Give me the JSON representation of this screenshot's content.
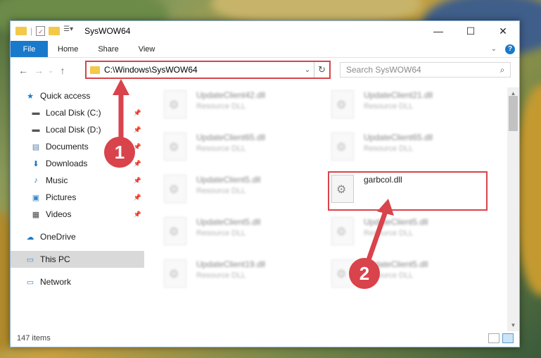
{
  "window": {
    "title": "SysWOW64",
    "controls": {
      "minimize": "—",
      "maximize": "☐",
      "close": "✕"
    }
  },
  "ribbon": {
    "tabs": [
      "File",
      "Home",
      "Share",
      "View"
    ],
    "help": "?"
  },
  "address": {
    "path": "C:\\Windows\\SysWOW64"
  },
  "search": {
    "placeholder": "Search SysWOW64"
  },
  "sidebar": {
    "quick_access": "Quick access",
    "items": [
      {
        "label": "Local Disk (C:)",
        "icon": "disk-icon",
        "pinned": true
      },
      {
        "label": "Local Disk (D:)",
        "icon": "disk-icon",
        "pinned": true
      },
      {
        "label": "Documents",
        "icon": "documents-icon",
        "pinned": true
      },
      {
        "label": "Downloads",
        "icon": "downloads-icon",
        "pinned": true
      },
      {
        "label": "Music",
        "icon": "music-icon",
        "pinned": true
      },
      {
        "label": "Pictures",
        "icon": "pictures-icon",
        "pinned": true
      },
      {
        "label": "Videos",
        "icon": "videos-icon",
        "pinned": true
      }
    ],
    "onedrive": "OneDrive",
    "this_pc": "This PC",
    "network": "Network"
  },
  "files": [
    {
      "name": "UpdateClient42.dll",
      "type": "Resource DLL"
    },
    {
      "name": "UpdateClient21.dll",
      "type": "Resource DLL"
    },
    {
      "name": "UpdateClient65.dll",
      "type": "Resource DLL"
    },
    {
      "name": "UpdateClient65.dll",
      "type": "Resource DLL"
    },
    {
      "name": "UpdateClient5.dll",
      "type": "Resource DLL"
    },
    {
      "name": "garbcol.dll",
      "type": ""
    },
    {
      "name": "UpdateClient5.dll",
      "type": "Resource DLL"
    },
    {
      "name": "UpdateClient5.dll",
      "type": "Resource DLL"
    },
    {
      "name": "UpdateClient19.dll",
      "type": "Resource DLL"
    },
    {
      "name": "UpdateClient5.dll",
      "type": "Resource DLL"
    }
  ],
  "status": {
    "item_count": "147 items"
  },
  "callouts": {
    "one": "1",
    "two": "2"
  },
  "colors": {
    "accent": "#1979ca",
    "highlight": "#d9434b"
  }
}
